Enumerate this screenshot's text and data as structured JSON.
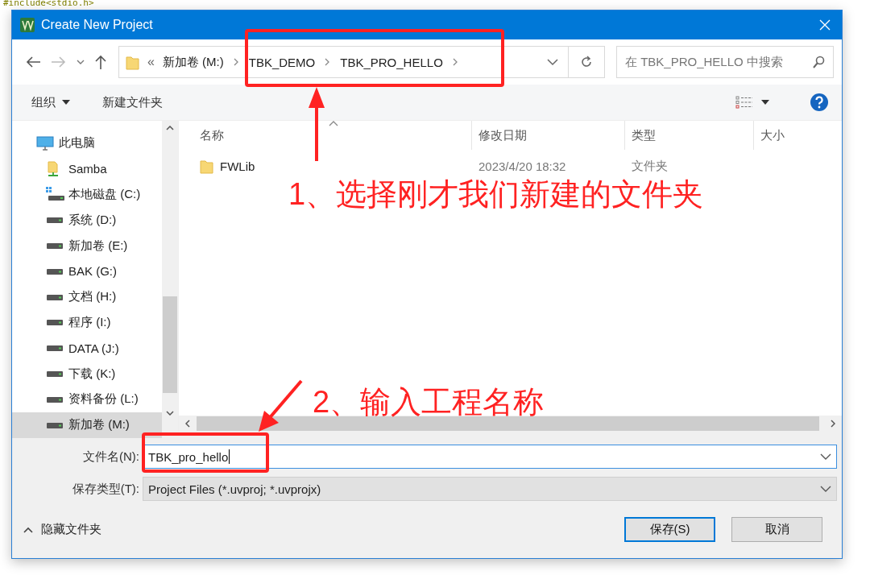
{
  "background_code": {
    "line": "#include<stdio.h>"
  },
  "window": {
    "title": "Create New Project"
  },
  "address_bar": {
    "overflow": "«",
    "crumbs": [
      "新加卷 (M:)",
      "TBK_DEMO",
      "TBK_PRO_HELLO"
    ]
  },
  "search": {
    "placeholder": "在 TBK_PRO_HELLO 中搜索"
  },
  "toolbar": {
    "organize": "组织",
    "new_folder": "新建文件夹"
  },
  "nav_pane": {
    "items": [
      {
        "label": "此电脑",
        "kind": "computer",
        "selected": false,
        "children": [
          {
            "label": "Samba",
            "kind": "network",
            "selected": false
          },
          {
            "label": "本地磁盘 (C:)",
            "kind": "system-drive",
            "selected": false
          },
          {
            "label": "系统 (D:)",
            "kind": "drive",
            "selected": false
          },
          {
            "label": "新加卷 (E:)",
            "kind": "drive",
            "selected": false
          },
          {
            "label": "BAK (G:)",
            "kind": "drive",
            "selected": false
          },
          {
            "label": "文档 (H:)",
            "kind": "drive",
            "selected": false
          },
          {
            "label": "程序 (I:)",
            "kind": "drive",
            "selected": false
          },
          {
            "label": "DATA (J:)",
            "kind": "drive",
            "selected": false
          },
          {
            "label": "下载 (K:)",
            "kind": "drive",
            "selected": false
          },
          {
            "label": "资料备份 (L:)",
            "kind": "drive",
            "selected": false
          },
          {
            "label": "新加卷 (M:)",
            "kind": "drive",
            "selected": true
          }
        ]
      }
    ]
  },
  "file_list": {
    "columns": [
      "名称",
      "修改日期",
      "类型",
      "大小"
    ],
    "rows": [
      {
        "name": "FWLib",
        "modified": "2023/4/20 18:32",
        "type": "文件夹",
        "selected": false
      }
    ]
  },
  "form": {
    "filename_label": "文件名(N):",
    "filename": "TBK_pro_hello",
    "type_label": "保存类型(T):",
    "type": "Project Files (*.uvproj; *.uvprojx)"
  },
  "hide_folders": "隐藏文件夹",
  "buttons": [
    {
      "label": "保存(S)",
      "default": true
    },
    {
      "label": "取消",
      "default": false
    }
  ],
  "annotations": [
    {
      "text": "1、选择刚才我们新建的文件夹"
    },
    {
      "text": "2、输入工程名称"
    }
  ]
}
